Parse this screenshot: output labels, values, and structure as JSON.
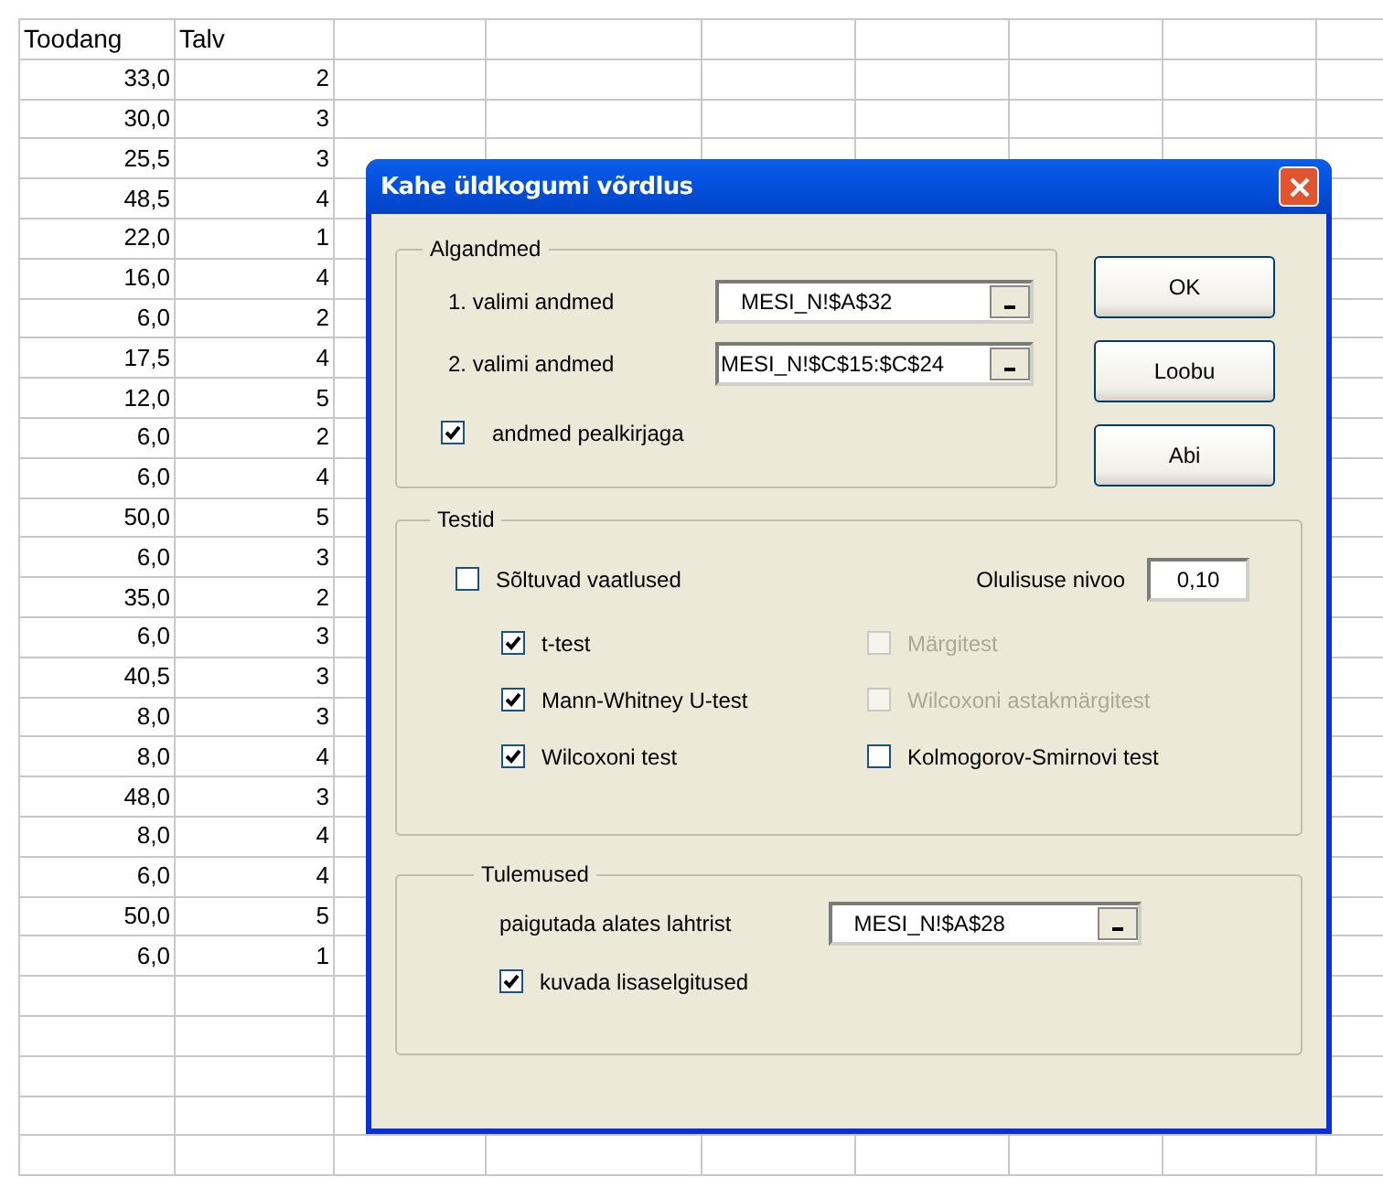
{
  "sheet": {
    "headers": [
      "Toodang",
      "Talv"
    ],
    "rows": [
      [
        "33,0",
        "2"
      ],
      [
        "30,0",
        "3"
      ],
      [
        "25,5",
        "3"
      ],
      [
        "48,5",
        "4"
      ],
      [
        "22,0",
        "1"
      ],
      [
        "16,0",
        "4"
      ],
      [
        "6,0",
        "2"
      ],
      [
        "17,5",
        "4"
      ],
      [
        "12,0",
        "5"
      ],
      [
        "6,0",
        "2"
      ],
      [
        "6,0",
        "4"
      ],
      [
        "50,0",
        "5"
      ],
      [
        "6,0",
        "3"
      ],
      [
        "35,0",
        "2"
      ],
      [
        "6,0",
        "3"
      ],
      [
        "40,5",
        "3"
      ],
      [
        "8,0",
        "3"
      ],
      [
        "8,0",
        "4"
      ],
      [
        "48,0",
        "3"
      ],
      [
        "8,0",
        "4"
      ],
      [
        "6,0",
        "4"
      ],
      [
        "50,0",
        "5"
      ],
      [
        "6,0",
        "1"
      ]
    ]
  },
  "dialog": {
    "title": "Kahe üldkogumi võrdlus",
    "input_group": {
      "title": "Algandmed",
      "ranges": [
        {
          "label": "1. valimi andmed",
          "value": "MESI_N!$A$32"
        },
        {
          "label": "2. valimi andmed",
          "value": "MESI_N!$C$15:$C$24"
        }
      ],
      "header_checkbox": {
        "label": "andmed pealkirjaga",
        "checked": true
      }
    },
    "buttons": [
      "OK",
      "Loobu",
      "Abi"
    ],
    "tests_group": {
      "title": "Testid",
      "dependent": {
        "label": "Sõltuvad vaatlused",
        "checked": false
      },
      "significance": {
        "label": "Olulisuse nivoo",
        "value": "0,10"
      },
      "columns": [
        [
          {
            "label": "t-test",
            "checked": true,
            "disabled": false
          },
          {
            "label": "Mann-Whitney U-test",
            "checked": true,
            "disabled": false
          },
          {
            "label": "Wilcoxoni test",
            "checked": true,
            "disabled": false
          }
        ],
        [
          {
            "label": "Märgitest",
            "checked": false,
            "disabled": true
          },
          {
            "label": "Wilcoxoni astakmärgitest",
            "checked": false,
            "disabled": true
          },
          {
            "label": "Kolmogorov-Smirnovi test",
            "checked": false,
            "disabled": false
          }
        ]
      ]
    },
    "output_group": {
      "title": "Tulemused",
      "range": {
        "label": "paigutada alates lahtrist",
        "value": "MESI_N!$A$28"
      },
      "explain_checkbox": {
        "label": "kuvada lisaselgitused",
        "checked": true
      }
    }
  }
}
